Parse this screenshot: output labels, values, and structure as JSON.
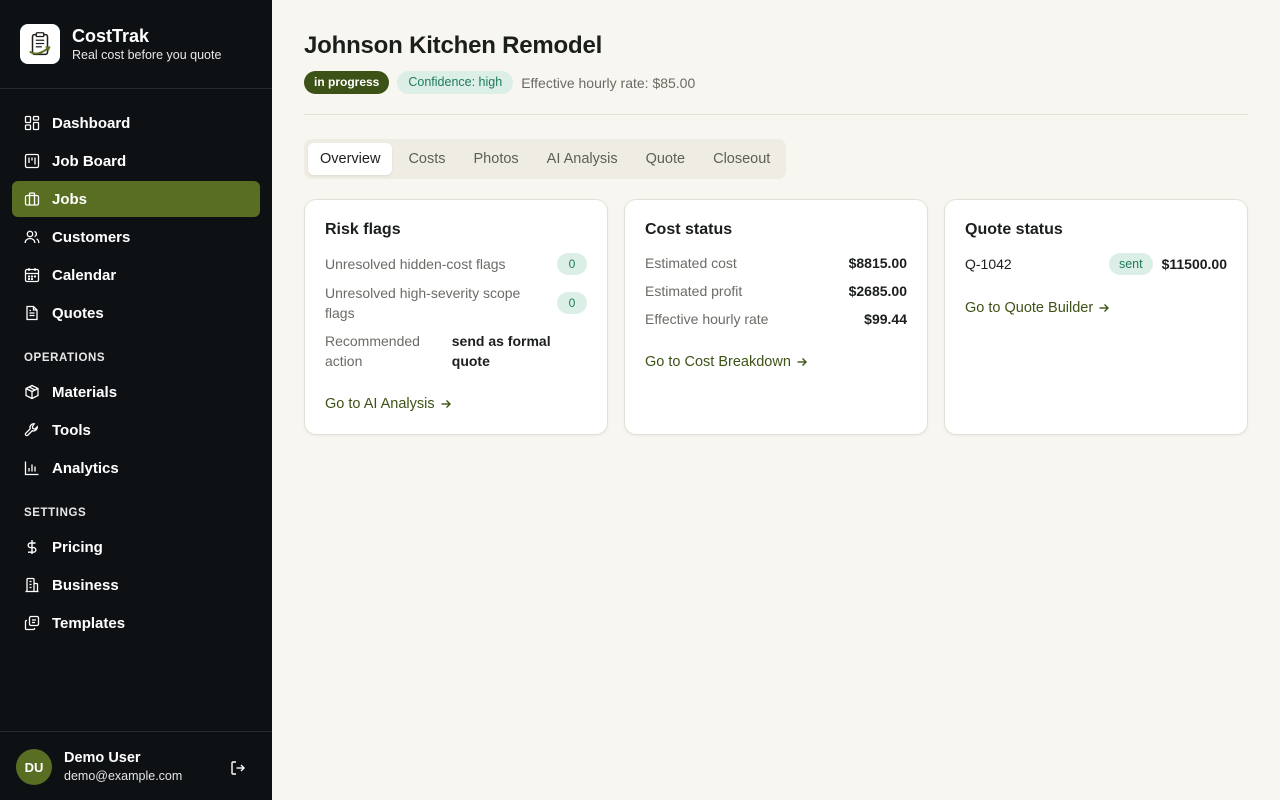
{
  "brand": {
    "name": "CostTrak",
    "tagline": "Real cost before you quote"
  },
  "nav": {
    "main_items": [
      {
        "label": "Dashboard",
        "icon": "dashboard-icon"
      },
      {
        "label": "Job Board",
        "icon": "kanban-icon"
      },
      {
        "label": "Jobs",
        "icon": "briefcase-icon",
        "active": true
      },
      {
        "label": "Customers",
        "icon": "users-icon"
      },
      {
        "label": "Calendar",
        "icon": "calendar-icon"
      },
      {
        "label": "Quotes",
        "icon": "document-icon"
      }
    ],
    "operations_heading": "OPERATIONS",
    "operations_items": [
      {
        "label": "Materials",
        "icon": "package-icon"
      },
      {
        "label": "Tools",
        "icon": "wrench-icon"
      },
      {
        "label": "Analytics",
        "icon": "bar-chart-icon"
      }
    ],
    "settings_heading": "SETTINGS",
    "settings_items": [
      {
        "label": "Pricing",
        "icon": "dollar-icon"
      },
      {
        "label": "Business",
        "icon": "building-icon"
      },
      {
        "label": "Templates",
        "icon": "templates-icon"
      }
    ]
  },
  "user": {
    "initials": "DU",
    "name": "Demo User",
    "email": "demo@example.com"
  },
  "job": {
    "title": "Johnson Kitchen Remodel",
    "status": "in progress",
    "confidence": "Confidence: high",
    "hourly_rate_text": "Effective hourly rate: $85.00"
  },
  "tabs": [
    "Overview",
    "Costs",
    "Photos",
    "AI Analysis",
    "Quote",
    "Closeout"
  ],
  "active_tab": "Overview",
  "risk_card": {
    "title": "Risk flags",
    "hidden_cost_label": "Unresolved hidden-cost flags",
    "hidden_cost_count": "0",
    "scope_label": "Unresolved high-severity scope flags",
    "scope_count": "0",
    "recommended_label": "Recommended action",
    "recommended_value": "send as formal quote",
    "link": "Go to AI Analysis"
  },
  "cost_card": {
    "title": "Cost status",
    "rows": [
      {
        "label": "Estimated cost",
        "value": "$8815.00"
      },
      {
        "label": "Estimated profit",
        "value": "$2685.00"
      },
      {
        "label": "Effective hourly rate",
        "value": "$99.44"
      }
    ],
    "link": "Go to Cost Breakdown"
  },
  "quote_card": {
    "title": "Quote status",
    "quote_id": "Q-1042",
    "status": "sent",
    "amount": "$11500.00",
    "link": "Go to Quote Builder"
  },
  "colors": {
    "sidebar_bg": "#0d1113",
    "accent": "#5a6e23",
    "status_badge": "#3d5217",
    "teal_badge_bg": "#dcefe7",
    "teal_badge_text": "#1f7a5e",
    "page_bg": "#f8f6f0"
  }
}
